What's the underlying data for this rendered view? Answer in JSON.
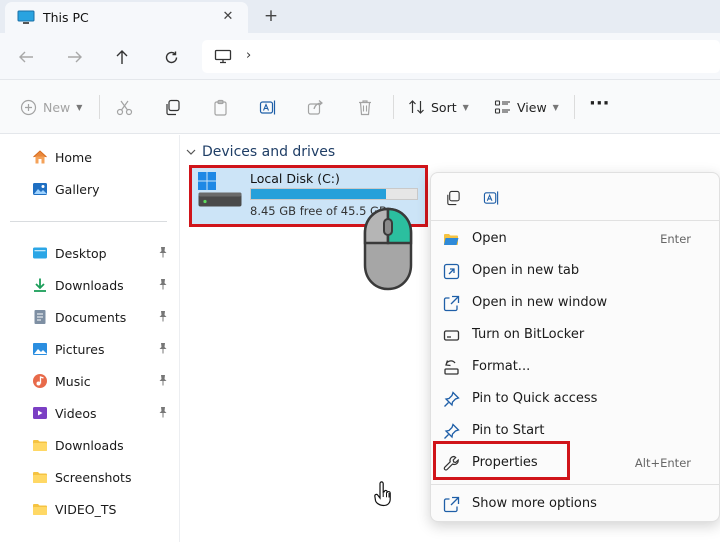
{
  "window": {
    "tab_title": "This PC",
    "close_glyph": "✕",
    "new_tab_glyph": "+"
  },
  "address": {
    "chevron": "›"
  },
  "toolbar": {
    "new_label": "New",
    "sort_label": "Sort",
    "view_label": "View",
    "more_glyph": "···"
  },
  "sidebar": {
    "top": [
      {
        "label": "Home",
        "icon": "home-icon"
      },
      {
        "label": "Gallery",
        "icon": "gallery-icon"
      }
    ],
    "quick_access": [
      {
        "label": "Desktop",
        "icon": "desktop-folder-icon",
        "pinned": true
      },
      {
        "label": "Downloads",
        "icon": "downloads-folder-icon",
        "pinned": true
      },
      {
        "label": "Documents",
        "icon": "documents-folder-icon",
        "pinned": true
      },
      {
        "label": "Pictures",
        "icon": "pictures-folder-icon",
        "pinned": true
      },
      {
        "label": "Music",
        "icon": "music-folder-icon",
        "pinned": true
      },
      {
        "label": "Videos",
        "icon": "videos-folder-icon",
        "pinned": true
      },
      {
        "label": "Downloads",
        "icon": "folder-icon",
        "pinned": false
      },
      {
        "label": "Screenshots",
        "icon": "folder-icon",
        "pinned": false
      },
      {
        "label": "VIDEO_TS",
        "icon": "folder-icon",
        "pinned": false
      }
    ]
  },
  "main": {
    "section_title": "Devices and drives",
    "drive": {
      "name": "Local Disk (C:)",
      "free_text": "8.45 GB free of 45.5 GB",
      "used_fraction": 0.814
    }
  },
  "context_menu": {
    "items": [
      {
        "label": "Open",
        "shortcut": "Enter",
        "icon": "open-folder-icon"
      },
      {
        "label": "Open in new tab",
        "shortcut": "",
        "icon": "new-tab-icon"
      },
      {
        "label": "Open in new window",
        "shortcut": "",
        "icon": "new-window-icon"
      },
      {
        "label": "Turn on BitLocker",
        "shortcut": "",
        "icon": "bitlocker-icon"
      },
      {
        "label": "Format...",
        "shortcut": "",
        "icon": "format-icon"
      },
      {
        "label": "Pin to Quick access",
        "shortcut": "",
        "icon": "pin-icon"
      },
      {
        "label": "Pin to Start",
        "shortcut": "",
        "icon": "pin-icon"
      },
      {
        "label": "Properties",
        "shortcut": "Alt+Enter",
        "icon": "wrench-icon"
      }
    ],
    "footer": {
      "label": "Show more options",
      "icon": "share-icon"
    }
  },
  "colors": {
    "highlight_red": "#d0141a",
    "drive_fill": "#26a0da",
    "selection": "#cce4f7",
    "mouse_button": "#2bbf9f"
  }
}
